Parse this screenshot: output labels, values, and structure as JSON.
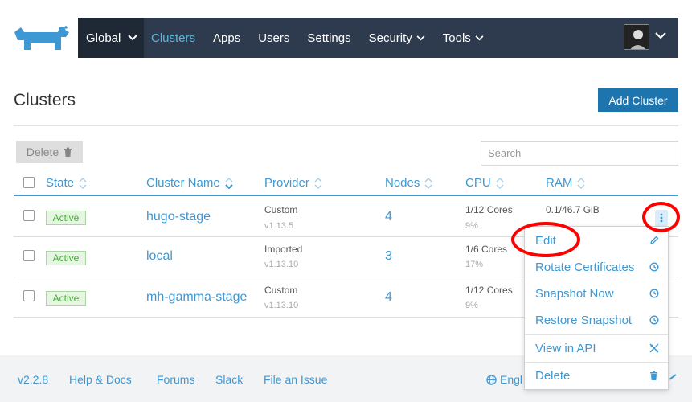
{
  "nav": {
    "global": "Global",
    "items": [
      "Clusters",
      "Apps",
      "Users",
      "Settings",
      "Security",
      "Tools"
    ]
  },
  "page": {
    "title": "Clusters",
    "add_button": "Add Cluster",
    "delete_button": "Delete",
    "search_placeholder": "Search"
  },
  "table": {
    "headers": [
      "State",
      "Cluster Name",
      "Provider",
      "Nodes",
      "CPU",
      "RAM"
    ],
    "rows": [
      {
        "state": "Active",
        "name": "hugo-stage",
        "provider": "Custom",
        "version": "v1.13.5",
        "nodes": "4",
        "cpu": "1/12 Cores",
        "cpu_pct": "9%",
        "ram": "0.1/46.7 GiB"
      },
      {
        "state": "Active",
        "name": "local",
        "provider": "Imported",
        "version": "v1.13.10",
        "nodes": "3",
        "cpu": "1/6 Cores",
        "cpu_pct": "17%",
        "ram": ""
      },
      {
        "state": "Active",
        "name": "mh-gamma-stage",
        "provider": "Custom",
        "version": "v1.13.10",
        "nodes": "4",
        "cpu": "1/12 Cores",
        "cpu_pct": "9%",
        "ram": ""
      }
    ]
  },
  "menu": {
    "items": [
      "Edit",
      "Rotate Certificates",
      "Snapshot Now",
      "Restore Snapshot",
      "View in API",
      "Delete"
    ]
  },
  "footer": {
    "version": "v2.2.8",
    "links": [
      "Help & Docs",
      "Forums",
      "Slack",
      "File an Issue"
    ],
    "language": "Engl"
  },
  "colors": {
    "nav_bg": "#2e3b4e",
    "accent": "#3d98d3",
    "primary_button": "#1e74ad",
    "active_badge": "#4aaa3c",
    "annotation": "#ff0000"
  }
}
